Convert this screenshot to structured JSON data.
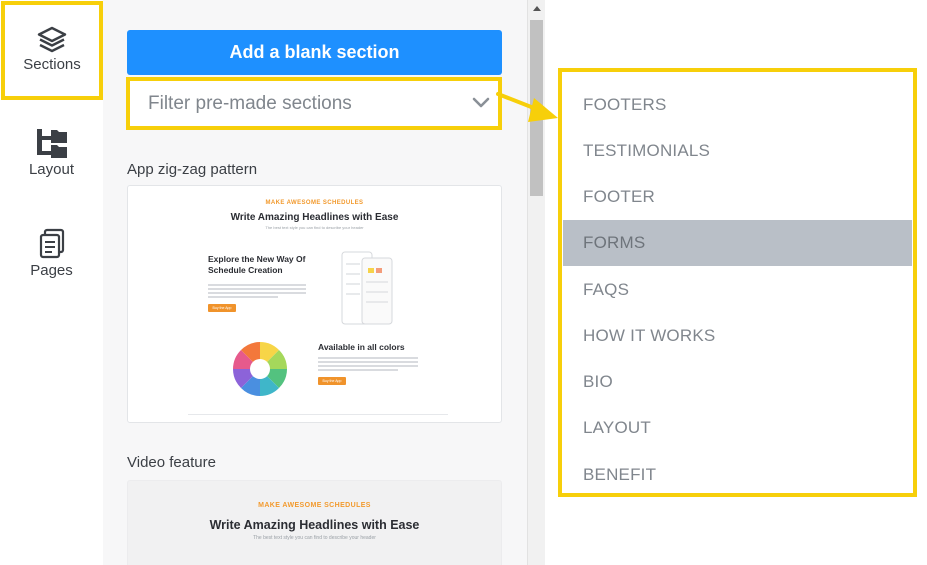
{
  "rail": {
    "items": [
      {
        "label": "Sections",
        "icon": "layers-icon",
        "active": true
      },
      {
        "label": "Layout",
        "icon": "layout-tree-icon",
        "active": false
      },
      {
        "label": "Pages",
        "icon": "pages-icon",
        "active": false
      }
    ]
  },
  "panel": {
    "add_button_label": "Add a blank section",
    "filter_placeholder": "Filter pre-made sections",
    "templates": [
      {
        "title": "App zig-zag pattern",
        "preview": {
          "kicker": "MAKE AWESOME SCHEDULES",
          "headline": "Write Amazing Headlines with Ease",
          "subline": "The best text style you can find to describe your header",
          "block1_title": "Explore the New Way Of Schedule Creation",
          "block1_button": "Buy the App",
          "block2_title": "Available in all colors",
          "block2_button": "Buy the App"
        }
      },
      {
        "title": "Video feature",
        "preview": {
          "kicker": "MAKE AWESOME SCHEDULES",
          "headline": "Write Amazing Headlines with Ease",
          "subline": "The best text style you can find to describe your header"
        }
      }
    ]
  },
  "dropdown": {
    "options": [
      "FOOTERS",
      "TESTIMONIALS",
      "FOOTER",
      "FORMS",
      "FAQS",
      "HOW IT WORKS",
      "BIO",
      "LAYOUT",
      "BENEFIT"
    ],
    "highlighted": "FORMS"
  },
  "colors": {
    "accent_yellow": "#f7cf0a",
    "primary_blue": "#1e90ff",
    "highlight_gray": "#b9bfc7",
    "orange": "#f0932b"
  }
}
